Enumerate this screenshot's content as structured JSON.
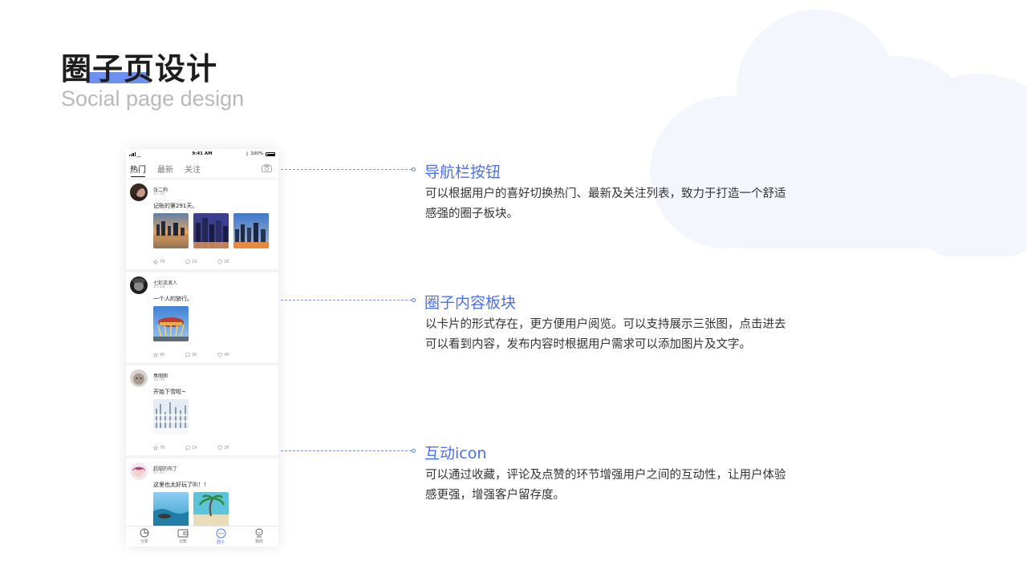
{
  "heading": {
    "title": "圈子页设计",
    "subtitle": "Social page design"
  },
  "phone": {
    "status": {
      "time": "9:41 AM",
      "battery": "100%"
    },
    "tabs": [
      {
        "label": "热门",
        "active": true
      },
      {
        "label": "最新",
        "active": false
      },
      {
        "label": "关注",
        "active": false
      }
    ],
    "posts": [
      {
        "name": "张二狗",
        "time": "11:30",
        "text": "记账的第291天。",
        "stats": [
          "78",
          "19",
          "28"
        ]
      },
      {
        "name": "七彩流浪人",
        "time": "13:16",
        "text": "一个人的旅行。",
        "stats": [
          "96",
          "30",
          "48"
        ]
      },
      {
        "name": "臭图图",
        "time": "16:49",
        "text": "开始下雪啦~",
        "stats": [
          "78",
          "19",
          "28"
        ]
      },
      {
        "name": "超甜的布丁",
        "time": "17:42",
        "text": "这里也太好玩了叭！！"
      }
    ],
    "tabbar": [
      {
        "label": "分析",
        "icon": "chart-pie-icon",
        "active": false
      },
      {
        "label": "记账",
        "icon": "wallet-icon",
        "active": false
      },
      {
        "label": "圈子",
        "icon": "chat-bubble-icon",
        "active": true
      },
      {
        "label": "我的",
        "icon": "profile-icon",
        "active": false
      }
    ]
  },
  "annotations": [
    {
      "title": "导航栏按钮",
      "lines": [
        "可以根据用户的喜好切换热门、最新及关注列表，致力于打造一个舒适",
        "感强的圈子板块。"
      ]
    },
    {
      "title": "圈子内容板块",
      "lines": [
        "以卡片的形式存在，更方便用户阅览。可以支持展示三张图，点击进去",
        "可以看到内容，发布内容时根据用户需求可以添加图片及文字。"
      ]
    },
    {
      "title": "互动icon",
      "lines": [
        "可以通过收藏，评论及点赞的环节增强用户之间的互动性，让用户体验",
        "感更强，增强客户留存度。"
      ]
    }
  ],
  "colors": {
    "accent": "#4a70ee",
    "highlight": "#6d8ff2",
    "cloud": "#f4f6fd"
  }
}
